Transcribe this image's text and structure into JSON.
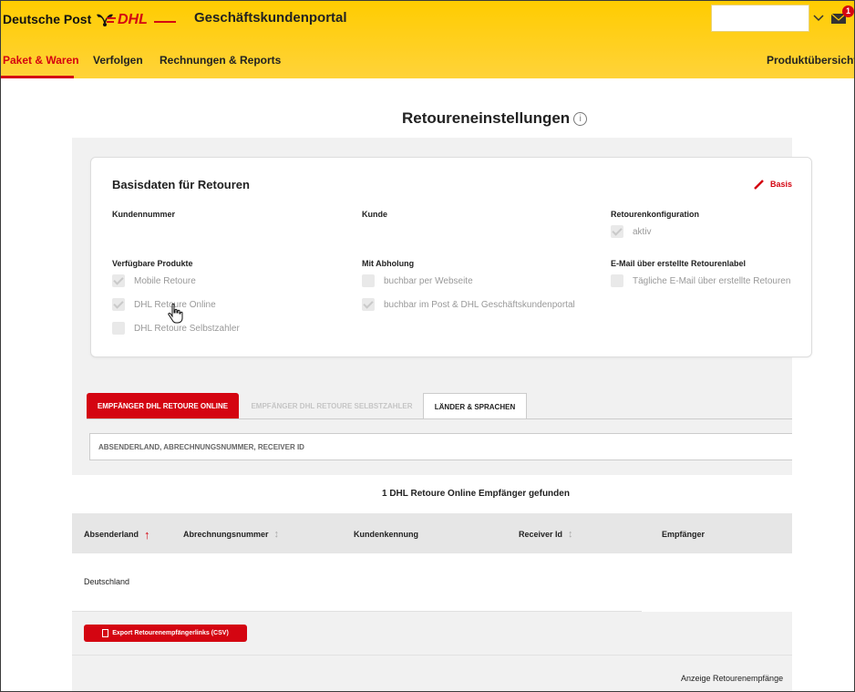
{
  "header": {
    "brand": "Deutsche Post",
    "dhl_logo": "DHL",
    "portal_title": "Geschäftskundenportal",
    "notification_count": "1",
    "icons": {
      "post_horn": "post-horn-icon",
      "chevron": "chevron-down-icon",
      "mail": "mail-icon"
    }
  },
  "nav": {
    "items": [
      {
        "label": "Paket & Waren",
        "active": true
      },
      {
        "label": "Verfolgen"
      },
      {
        "label": "Rechnungen & Reports"
      }
    ],
    "right_label": "Produktübersicht"
  },
  "page": {
    "title": "Retoureneinstellungen",
    "info_icon": "i"
  },
  "card": {
    "title": "Basisdaten für Retouren",
    "edit_label": "Basis",
    "col1": {
      "kundennummer_label": "Kundennummer",
      "products_label": "Verfügbare Produkte",
      "products": [
        {
          "label": "Mobile Retoure",
          "checked": true
        },
        {
          "label": "DHL Retoure Online",
          "checked": true
        },
        {
          "label": "DHL Retoure Selbstzahler",
          "checked": false
        }
      ]
    },
    "col2": {
      "kunde_label": "Kunde",
      "pickup_label": "Mit Abholung",
      "pickup": [
        {
          "label": "buchbar per Webseite",
          "checked": false
        },
        {
          "label": "buchbar im Post & DHL Geschäftskundenportal",
          "checked": true
        }
      ]
    },
    "col3": {
      "config_label": "Retourenkonfiguration",
      "config": [
        {
          "label": "aktiv",
          "checked": true
        }
      ],
      "email_label": "E-Mail über erstellte Retourenlabel",
      "email": [
        {
          "label": "Tägliche E-Mail über erstellte Retouren",
          "checked": false
        }
      ]
    }
  },
  "tabs": [
    {
      "label": "Empfänger DHL Retoure Online",
      "state": "active"
    },
    {
      "label": "Empfänger DHL Retoure Selbstzahler",
      "state": "disabled"
    },
    {
      "label": "Länder & Sprachen",
      "state": "normal"
    }
  ],
  "search": {
    "placeholder": "Absenderland, Abrechnungsnummer, Receiver ID"
  },
  "results": {
    "count_text": "1 DHL Retoure Online Empfänger gefunden"
  },
  "table": {
    "columns": [
      {
        "label": "Absenderland",
        "sort": "asc"
      },
      {
        "label": "Abrechnungsnummer",
        "sort": "both"
      },
      {
        "label": "Kundenkennung"
      },
      {
        "label": "Receiver Id",
        "sort": "both"
      },
      {
        "label": "Empfänger"
      }
    ],
    "rows": [
      {
        "absenderland": "Deutschland"
      }
    ]
  },
  "footer": {
    "export_label": "Export Retourenempfängerlinks (CSV)",
    "display_text": "Anzeige Retourenempfänge"
  },
  "colors": {
    "brand_yellow": "#ffcc00",
    "brand_red": "#d40511"
  }
}
